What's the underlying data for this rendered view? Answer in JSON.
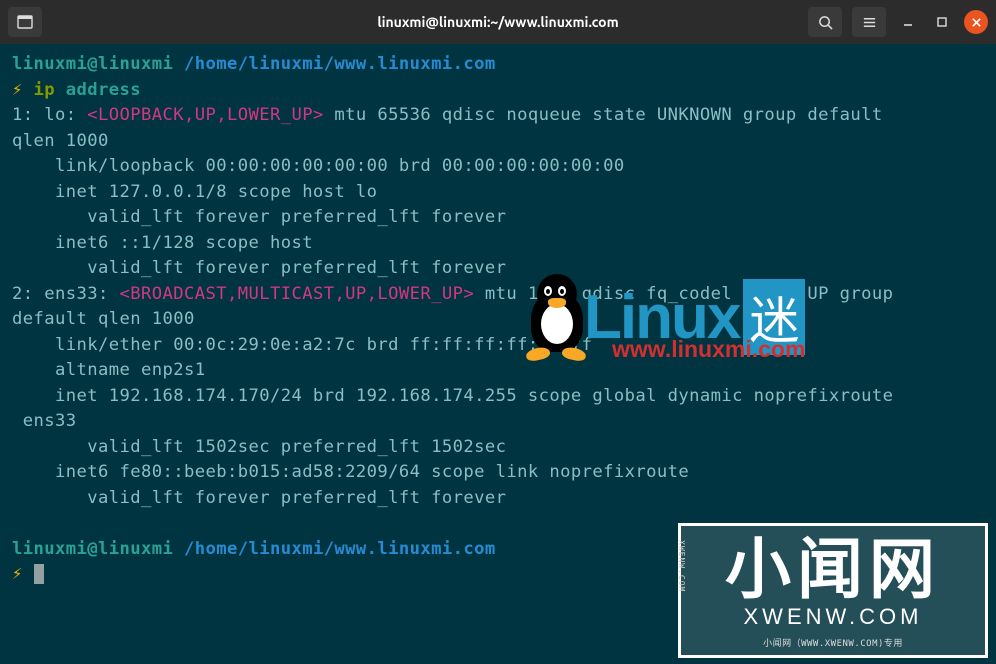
{
  "titlebar": {
    "title": "linuxmi@linuxmi:~/www.linuxmi.com"
  },
  "prompt": {
    "user_host": "linuxmi@linuxmi",
    "path": "/home/linuxmi/www.linuxmi.com",
    "symbol": "⚡",
    "cmd_name": "ip",
    "cmd_arg": "address"
  },
  "output": {
    "l1a": "1: lo: ",
    "l1b": "<LOOPBACK,UP,LOWER_UP>",
    "l1c": " mtu 65536 qdisc noqueue state UNKNOWN group default ",
    "l2": "qlen 1000",
    "l3": "    link/loopback 00:00:00:00:00:00 brd 00:00:00:00:00:00",
    "l4": "    inet 127.0.0.1/8 scope host lo",
    "l5": "       valid_lft forever preferred_lft forever",
    "l6": "    inet6 ::1/128 scope host ",
    "l7": "       valid_lft forever preferred_lft forever",
    "l8a": "2: ens33: ",
    "l8b": "<BROADCAST,MULTICAST,UP,LOWER_UP>",
    "l8c": " mtu 1500 qdisc fq_codel state UP group ",
    "l9": "default qlen 1000",
    "l10": "    link/ether 00:0c:29:0e:a2:7c brd ff:ff:ff:ff:ff:ff",
    "l11": "    altname enp2s1",
    "l12": "    inet 192.168.174.170/24 brd 192.168.174.255 scope global dynamic noprefixroute",
    "l13": " ens33",
    "l14": "       valid_lft 1502sec preferred_lft 1502sec",
    "l15": "    inet6 fe80::beeb:b015:ad58:2209/64 scope link noprefixroute ",
    "l16": "       valid_lft forever preferred_lft forever"
  },
  "watermark1": {
    "text": "Linux",
    "mi": "迷",
    "url": "www.linuxmi.com"
  },
  "watermark2": {
    "big": "小闻网",
    "sub": "XWENW.COM",
    "footer": "小闻网（WWW.XWENW.COM)专用",
    "side": "XWENW.COM"
  }
}
